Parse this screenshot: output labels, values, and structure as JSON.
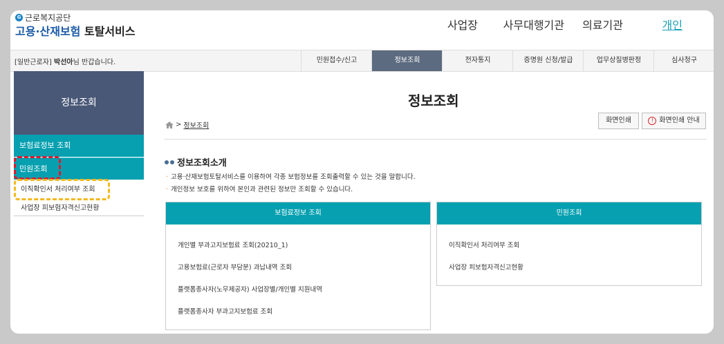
{
  "header": {
    "org_name": "근로복지공단",
    "service_main": "고용·산재보험",
    "service_sub": "토탈서비스",
    "top_nav": [
      "사업장",
      "사무대행기관",
      "의료기관",
      "개인"
    ]
  },
  "gnb": {
    "greeting_role": "[일반근로자]",
    "greeting_name": "박선아",
    "greeting_suffix": "님 반갑습니다.",
    "items": [
      "민원접수/신고",
      "정보조회",
      "전자통지",
      "증명원 신청/발급",
      "업무상질병판정",
      "심사청구"
    ]
  },
  "sidebar": {
    "title": "정보조회",
    "menus": [
      "보험료정보 조회",
      "민원조회"
    ],
    "subs": [
      "이직확인서 처리여부 조회",
      "사업장 피보험자격신고현황"
    ]
  },
  "main": {
    "title": "정보조회",
    "breadcrumb": "정보조회",
    "print_button": "화면인쇄",
    "print_guide_button": "화면인쇄 안내",
    "intro_title": "정보조회소개",
    "intro_lines": [
      "고용·산재보험토탈서비스를 이용하여 각종 보험정보를 조회출력할 수 있는 것을 말합니다.",
      "개인정보 보호를 위하여 본인과 관련된 정보만 조회할 수 있습니다."
    ],
    "panels": [
      {
        "title": "보험료정보 조회",
        "items": [
          "개인별 부과고지보험료 조회(20210_1)",
          "고용보험료(근로자 부담분) 과납내역 조회",
          "플랫폼종사자(노무제공자) 사업장별/개인별 지원내역",
          "플랫폼종사자 부과고지보험료 조회"
        ]
      },
      {
        "title": "민원조회",
        "items": [
          "이직확인서 처리여부 조회",
          "사업장 피보험자격신고현황"
        ]
      }
    ]
  },
  "colors": {
    "teal": "#06a0b0",
    "navy": "#4a5878",
    "gnb_active": "#5c6b7f",
    "highlight_red": "#e2172a",
    "highlight_yellow": "#f3b81d"
  }
}
